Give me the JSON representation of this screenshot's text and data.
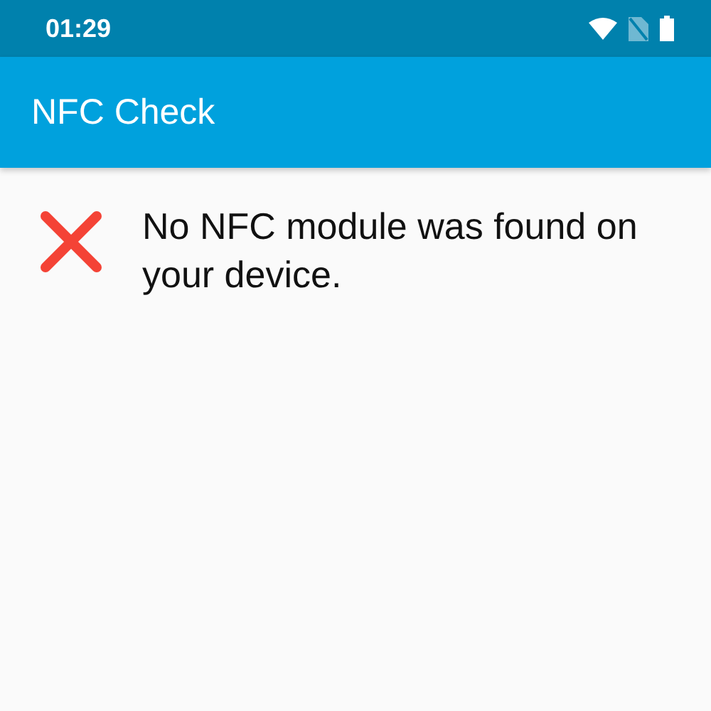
{
  "status_bar": {
    "time": "01:29"
  },
  "app_bar": {
    "title": "NFC Check"
  },
  "message": {
    "kind": "error",
    "text": "No NFC module was found on your device."
  }
}
